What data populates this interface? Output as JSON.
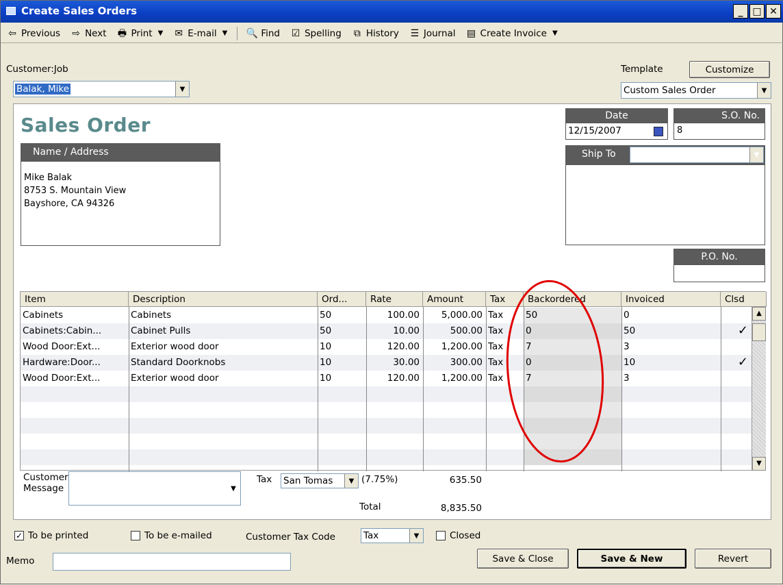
{
  "window": {
    "title": "Create Sales Orders"
  },
  "toolbar": {
    "previous": "Previous",
    "next": "Next",
    "print": "Print",
    "email": "E-mail",
    "find": "Find",
    "spelling": "Spelling",
    "history": "History",
    "journal": "Journal",
    "create_invoice": "Create Invoice"
  },
  "header": {
    "customer_job_label": "Customer:Job",
    "customer_value": "Balak, Mike",
    "template_label": "Template",
    "customize_label": "Customize",
    "template_value": "Custom Sales Order"
  },
  "form": {
    "title": "Sales Order",
    "date_label": "Date",
    "date_value": "12/15/2007",
    "so_label": "S.O. No.",
    "so_value": "8",
    "name_address_label": "Name / Address",
    "address_lines": [
      "Mike Balak",
      "8753 S. Mountain View",
      "Bayshore, CA  94326"
    ],
    "ship_to_label": "Ship To",
    "po_label": "P.O. No."
  },
  "grid": {
    "columns": [
      "Item",
      "Description",
      "Ord...",
      "Rate",
      "Amount",
      "Tax",
      "Backordered",
      "Invoiced",
      "Clsd"
    ],
    "rows": [
      {
        "item": "Cabinets",
        "desc": "Cabinets",
        "ord": "50",
        "rate": "100.00",
        "amount": "5,000.00",
        "tax": "Tax",
        "back": "50",
        "inv": "0",
        "clsd": ""
      },
      {
        "item": "Cabinets:Cabin...",
        "desc": "Cabinet Pulls",
        "ord": "50",
        "rate": "10.00",
        "amount": "500.00",
        "tax": "Tax",
        "back": "0",
        "inv": "50",
        "clsd": "✓"
      },
      {
        "item": "Wood Door:Ext...",
        "desc": "Exterior wood door",
        "ord": "10",
        "rate": "120.00",
        "amount": "1,200.00",
        "tax": "Tax",
        "back": "7",
        "inv": "3",
        "clsd": ""
      },
      {
        "item": "Hardware:Door...",
        "desc": "Standard Doorknobs",
        "ord": "10",
        "rate": "30.00",
        "amount": "300.00",
        "tax": "Tax",
        "back": "0",
        "inv": "10",
        "clsd": "✓"
      },
      {
        "item": "Wood Door:Ext...",
        "desc": "Exterior wood door",
        "ord": "10",
        "rate": "120.00",
        "amount": "1,200.00",
        "tax": "Tax",
        "back": "7",
        "inv": "3",
        "clsd": ""
      }
    ]
  },
  "footer": {
    "customer_message_label_1": "Customer",
    "customer_message_label_2": "Message",
    "tax_label": "Tax",
    "tax_item": "San Tomas",
    "tax_rate": "(7.75%)",
    "tax_amount": "635.50",
    "total_label": "Total",
    "total_amount": "8,835.50"
  },
  "bottom": {
    "to_be_printed": "To be printed",
    "to_be_emailed": "To be e-mailed",
    "customer_tax_code_label": "Customer Tax Code",
    "customer_tax_code": "Tax",
    "closed_label": "Closed",
    "memo_label": "Memo",
    "save_close": "Save & Close",
    "save_new": "Save & New",
    "revert": "Revert"
  },
  "colors": {
    "accent": "#5a8a8c",
    "annotation": "#e00000"
  }
}
